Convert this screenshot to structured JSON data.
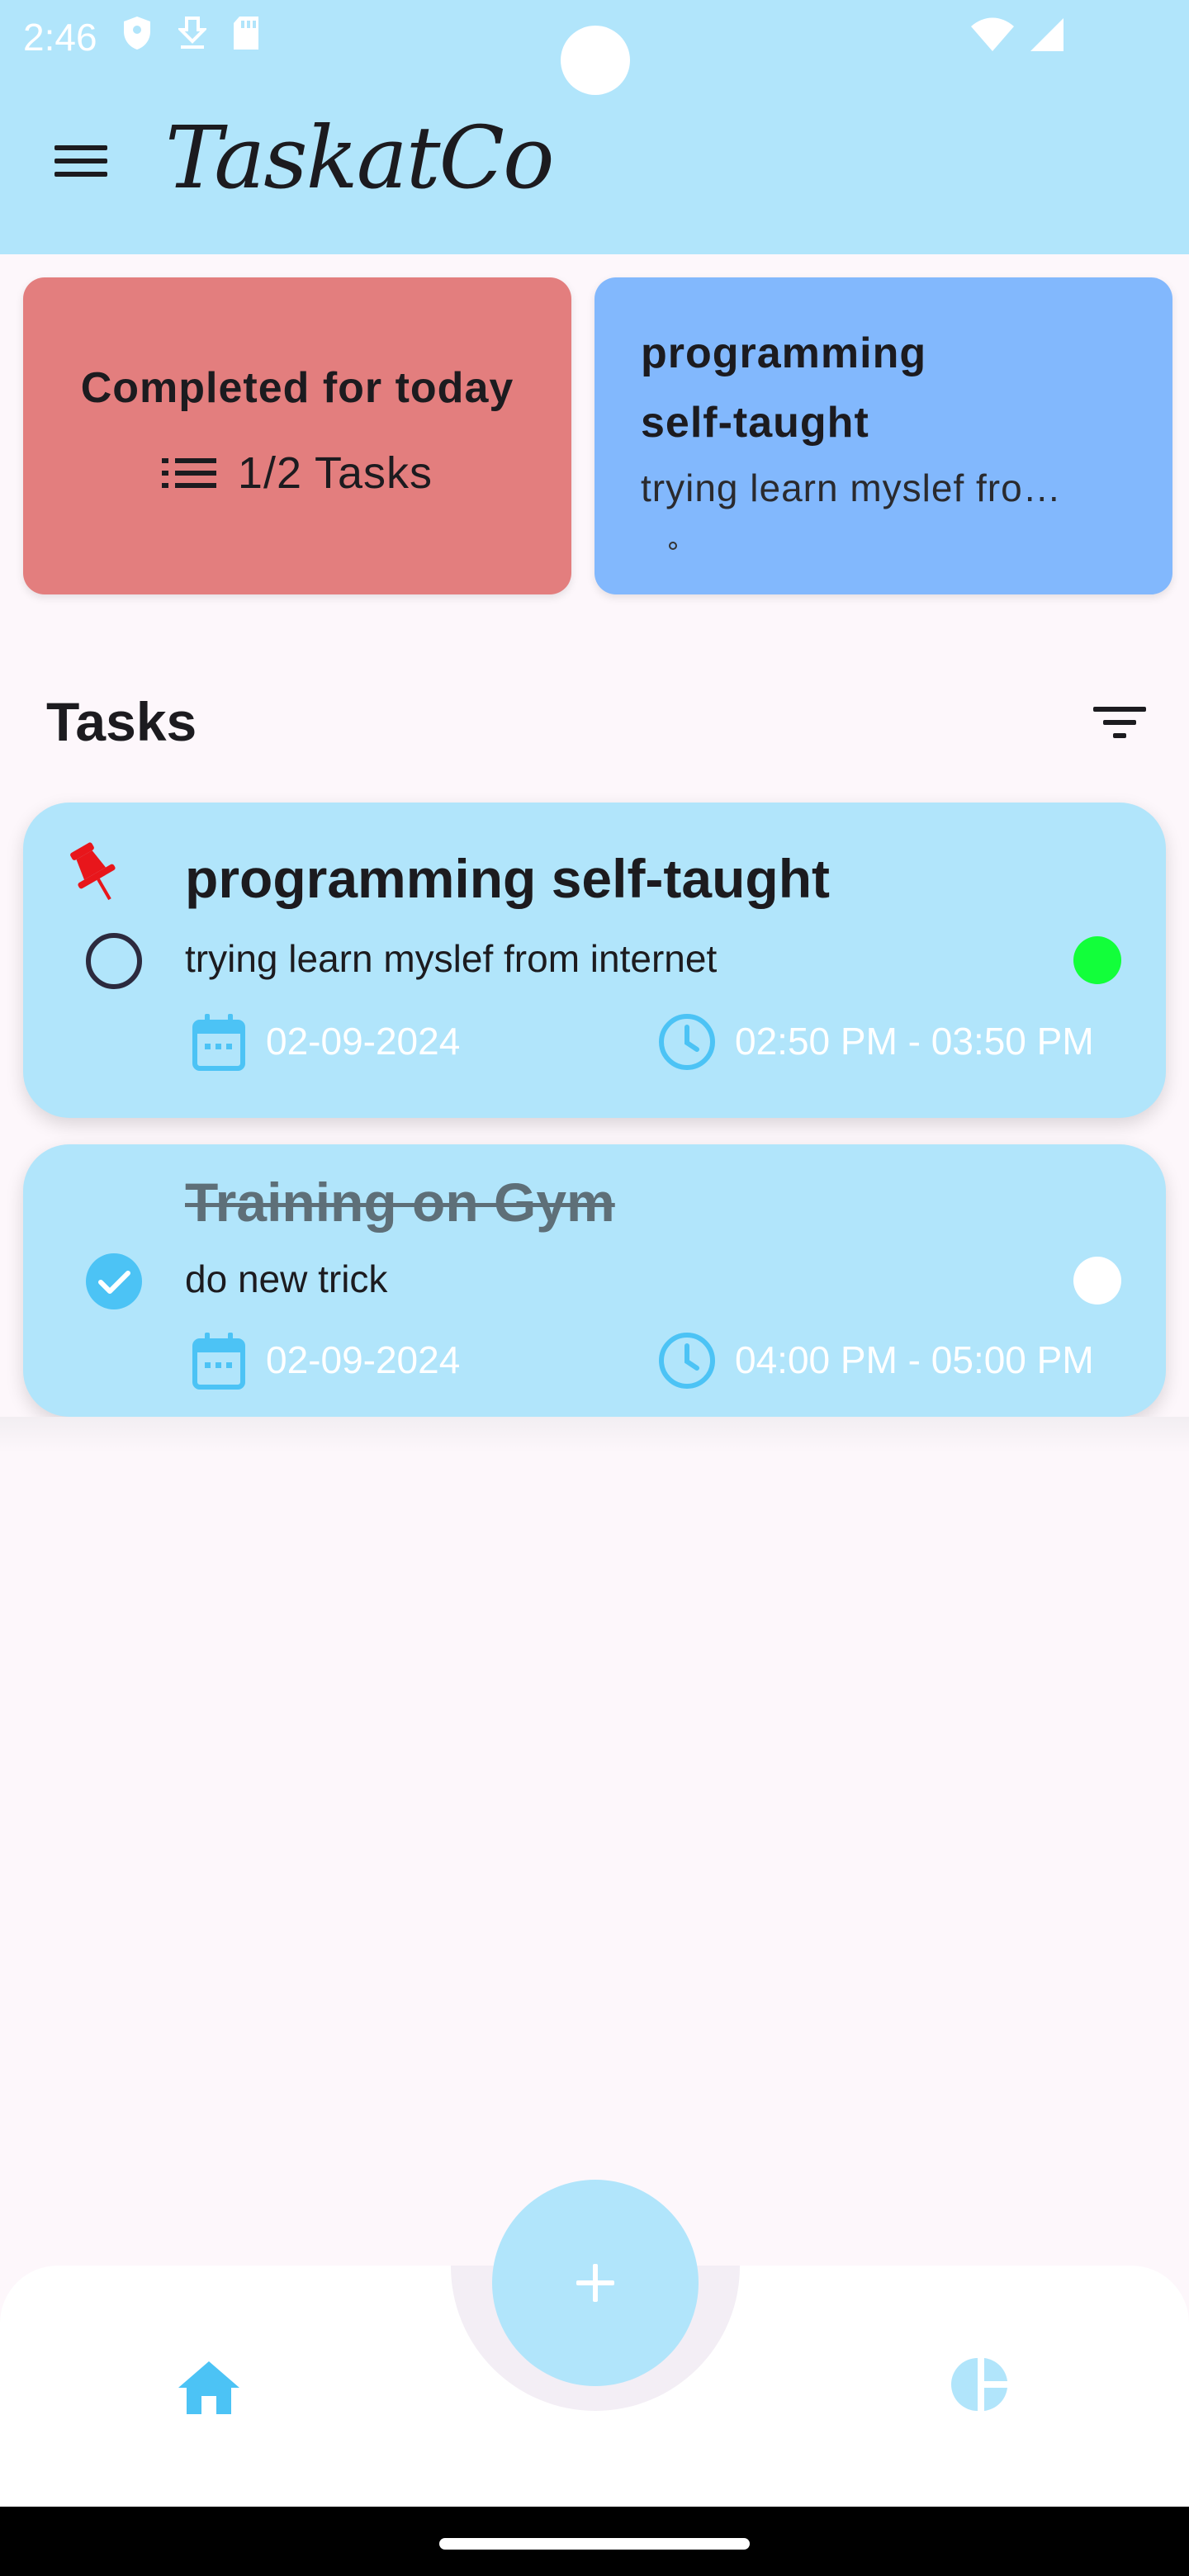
{
  "status_bar": {
    "time": "2:46"
  },
  "app_bar": {
    "title": "TaskatCo",
    "menu_icon": "hamburger-menu-icon"
  },
  "summary": {
    "completed_title": "Completed for today",
    "completed_count": "1/2 Tasks",
    "featured_title": "programming self-taught",
    "featured_description": "trying learn myslef fro…"
  },
  "tasks_section": {
    "heading": "Tasks",
    "filter_icon": "filter-icon"
  },
  "tasks": [
    {
      "title": "programming self-taught",
      "description": "trying learn myslef from internet",
      "date": "02-09-2024",
      "time": "02:50 PM - 03:50 PM",
      "pinned": true,
      "completed": false,
      "status_color": "#12ff3a"
    },
    {
      "title": "Training on Gym",
      "description": "do new trick",
      "date": "02-09-2024",
      "time": "04:00 PM - 05:00 PM",
      "pinned": false,
      "completed": true,
      "status_color": "#ffffff"
    }
  ],
  "bottom_nav": {
    "items": [
      "home-icon",
      "statistics-icon"
    ],
    "fab_icon": "plus-icon"
  },
  "colors": {
    "primary": "#b1e5fb",
    "accent": "#4cc3f5",
    "completed_card": "#e37e7e",
    "featured_card": "#82b8fd",
    "pin": "#e8161b"
  }
}
